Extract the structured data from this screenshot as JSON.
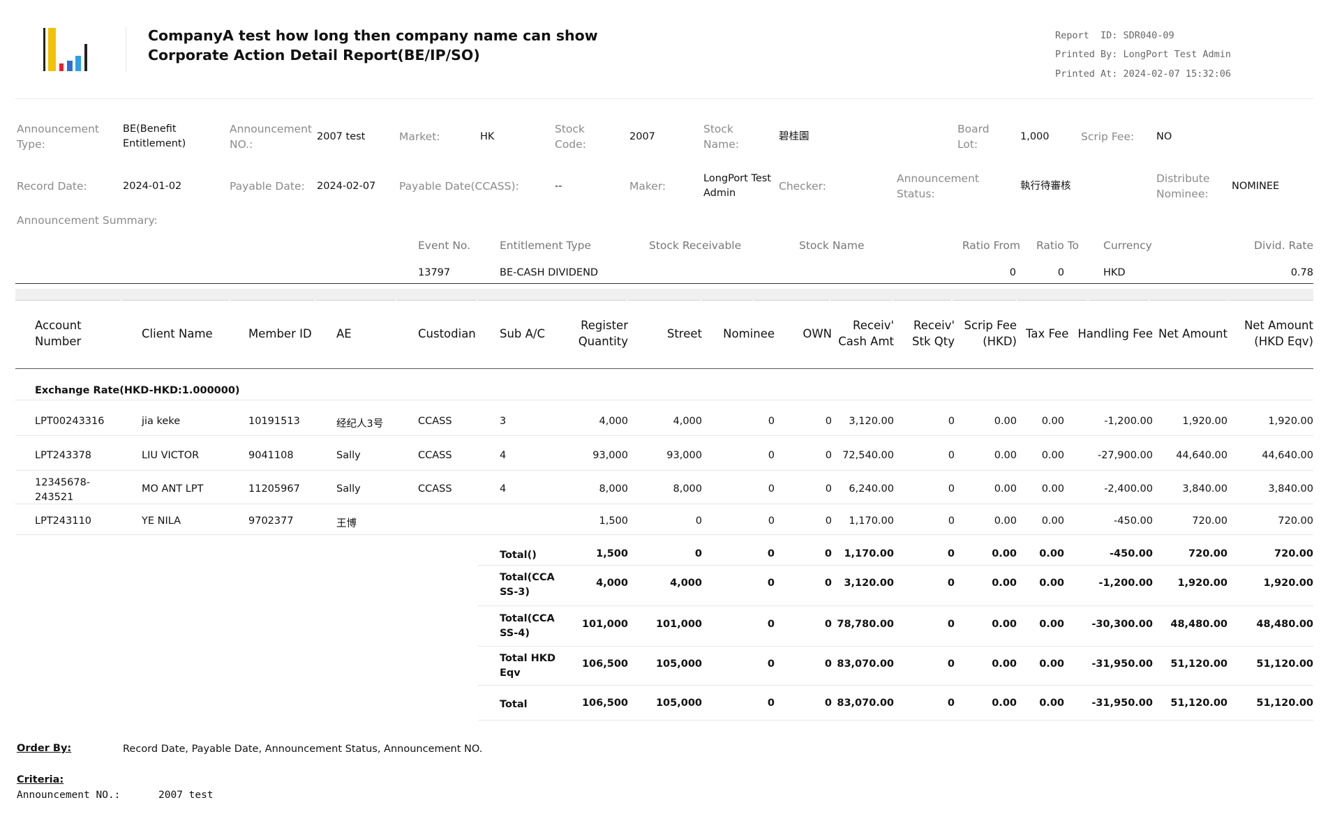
{
  "header": {
    "title_line1": "CompanyA test how long then company name can show",
    "title_line2": "Corporate Action Detail Report(BE/IP/SO)",
    "report_id": "Report  ID: SDR040-09",
    "printed_by": "Printed By: LongPort Test Admin",
    "printed_at": "Printed At: 2024-02-07 15:32:06",
    "logo_colors": [
      "#222222",
      "#f2c200",
      "#e8202a",
      "#2a6fd6",
      "#2ba0e8",
      "#222222"
    ]
  },
  "info": {
    "ann_type_label": "Announcement Type:",
    "ann_type_value": "BE(Benefit Entitlement)",
    "ann_no_label": "Announcement NO.:",
    "ann_no_value": "2007 test",
    "market_label": "Market:",
    "market_value": "HK",
    "stock_code_label": "Stock Code:",
    "stock_code_value": "2007",
    "stock_name_label": "Stock Name:",
    "stock_name_value": "碧桂園",
    "board_lot_label": "Board Lot:",
    "board_lot_value": "1,000",
    "scrip_fee_label": "Scrip Fee:",
    "scrip_fee_value": "NO",
    "record_date_label": "Record Date:",
    "record_date_value": "2024-01-02",
    "payable_date_label": "Payable Date:",
    "payable_date_value": "2024-02-07",
    "payable_ccass_label": "Payable Date(CCASS):",
    "payable_ccass_value": "--",
    "maker_label": "Maker:",
    "maker_value": "LongPort Test Admin",
    "checker_label": "Checker:",
    "checker_value": "",
    "ann_status_label": "Announcement Status:",
    "ann_status_value": "執行待審核",
    "distribute_label": "Distribute Nominee:",
    "distribute_value": "NOMINEE",
    "summary_label": "Announcement Summary:"
  },
  "event": {
    "headers": [
      "Event No.",
      "Entitlement Type",
      "Stock Receivable",
      "Stock Name",
      "Ratio From",
      "Ratio To",
      "Currency",
      "Divid. Rate"
    ],
    "row": [
      "13797",
      "BE-CASH DIVIDEND",
      "",
      "",
      "0",
      "0",
      "HKD",
      "0.78"
    ]
  },
  "table": {
    "headers": [
      "Account Number",
      "Client Name",
      "Member ID",
      "AE",
      "Custodian",
      "Sub A/C",
      "Register Quantity",
      "Street",
      "Nominee",
      "OWN",
      "Receiv' Cash Amt",
      "Receiv' Stk Qty",
      "Scrip Fee (HKD)",
      "Tax Fee",
      "Handling Fee",
      "Net Amount",
      "Net Amount (HKD Eqv)"
    ],
    "exchange_rate": "Exchange Rate(HKD-HKD:1.000000)",
    "rows": [
      [
        "LPT00243316",
        "jia keke",
        "10191513",
        "经纪人3号",
        "CCASS",
        "3",
        "4,000",
        "4,000",
        "0",
        "0",
        "3,120.00",
        "0",
        "0.00",
        "0.00",
        "-1,200.00",
        "1,920.00",
        "1,920.00"
      ],
      [
        "LPT243378",
        "LIU VICTOR",
        "9041108",
        "Sally",
        "CCASS",
        "4",
        "93,000",
        "93,000",
        "0",
        "0",
        "72,540.00",
        "0",
        "0.00",
        "0.00",
        "-27,900.00",
        "44,640.00",
        "44,640.00"
      ],
      [
        "12345678-243521",
        "MO ANT LPT",
        "11205967",
        "Sally",
        "CCASS",
        "4",
        "8,000",
        "8,000",
        "0",
        "0",
        "6,240.00",
        "0",
        "0.00",
        "0.00",
        "-2,400.00",
        "3,840.00",
        "3,840.00"
      ],
      [
        "LPT243110",
        "YE NILA",
        "9702377",
        "王博",
        "",
        "",
        "1,500",
        "0",
        "0",
        "0",
        "1,170.00",
        "0",
        "0.00",
        "0.00",
        "-450.00",
        "720.00",
        "720.00"
      ]
    ],
    "totals": [
      {
        "label": "Total()",
        "values": [
          "1,500",
          "0",
          "0",
          "0",
          "1,170.00",
          "0",
          "0.00",
          "0.00",
          "-450.00",
          "720.00",
          "720.00"
        ]
      },
      {
        "label": "Total(CCASS-3)",
        "values": [
          "4,000",
          "4,000",
          "0",
          "0",
          "3,120.00",
          "0",
          "0.00",
          "0.00",
          "-1,200.00",
          "1,920.00",
          "1,920.00"
        ]
      },
      {
        "label": "Total(CCASS-4)",
        "values": [
          "101,000",
          "101,000",
          "0",
          "0",
          "78,780.00",
          "0",
          "0.00",
          "0.00",
          "-30,300.00",
          "48,480.00",
          "48,480.00"
        ]
      },
      {
        "label": "Total HKD Eqv",
        "values": [
          "106,500",
          "105,000",
          "0",
          "0",
          "83,070.00",
          "0",
          "0.00",
          "0.00",
          "-31,950.00",
          "51,120.00",
          "51,120.00"
        ]
      },
      {
        "label": "Total",
        "values": [
          "106,500",
          "105,000",
          "0",
          "0",
          "83,070.00",
          "0",
          "0.00",
          "0.00",
          "-31,950.00",
          "51,120.00",
          "51,120.00"
        ]
      }
    ]
  },
  "footer": {
    "order_by_label": "Order By:",
    "order_by_value": "Record Date, Payable Date, Announcement Status, Announcement NO.",
    "criteria_label": "Criteria:",
    "criteria_key": "Announcement NO.:",
    "criteria_value": "2007 test"
  }
}
